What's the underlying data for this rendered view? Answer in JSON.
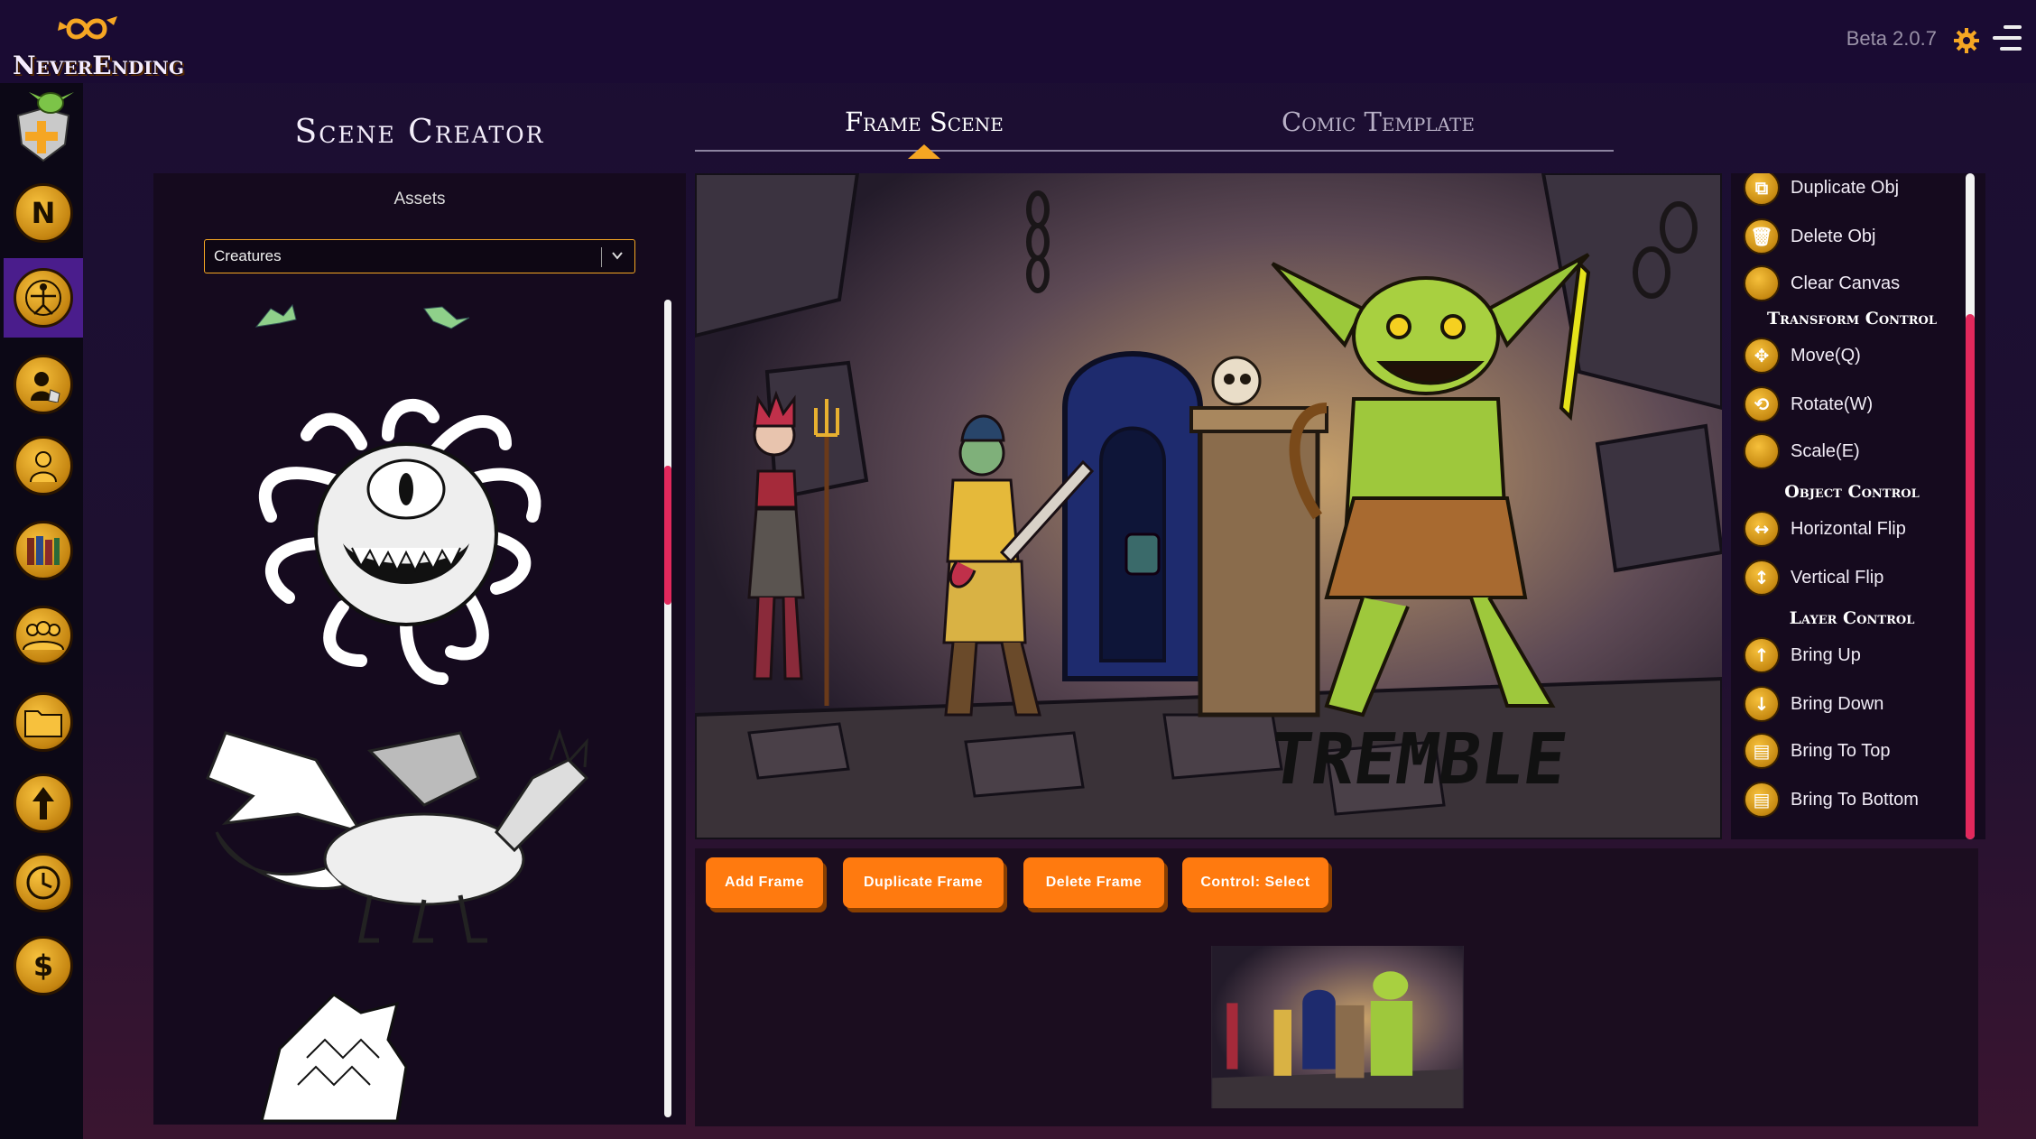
{
  "app": {
    "logo_text": "NeverEnding",
    "version": "Beta 2.0.7"
  },
  "sidebar": {
    "items": [
      {
        "name": "goblin-shield",
        "icon": "goblin-shield-icon"
      },
      {
        "name": "neverending-n",
        "icon": "n-logo-icon"
      },
      {
        "name": "scene-creator",
        "icon": "vitruvian-man-icon",
        "active": true
      },
      {
        "name": "character-dice",
        "icon": "character-dice-icon"
      },
      {
        "name": "profile",
        "icon": "person-icon"
      },
      {
        "name": "library",
        "icon": "books-icon"
      },
      {
        "name": "party",
        "icon": "group-icon"
      },
      {
        "name": "folder",
        "icon": "folder-icon"
      },
      {
        "name": "upgrade",
        "icon": "arrow-up-icon"
      },
      {
        "name": "history",
        "icon": "clock-icon"
      },
      {
        "name": "billing",
        "icon": "dollar-icon"
      }
    ]
  },
  "page": {
    "title": "Scene Creator"
  },
  "tabs": [
    {
      "label": "Frame Scene",
      "active": true
    },
    {
      "label": "Comic Template",
      "active": false
    }
  ],
  "assets": {
    "label": "Assets",
    "category": "Creatures",
    "items": [
      "beholder",
      "dragon",
      "wyvern-wing"
    ]
  },
  "canvas": {
    "caption": "TREMBLE"
  },
  "tools": {
    "actions": [
      {
        "label": "Duplicate Obj",
        "icon": "duplicate-icon"
      },
      {
        "label": "Delete Obj",
        "icon": "trash-icon"
      },
      {
        "label": "Clear Canvas",
        "icon": "clear-icon"
      }
    ],
    "transform_heading": "Transform Control",
    "transform": [
      {
        "label": "Move(Q)",
        "icon": "move-icon"
      },
      {
        "label": "Rotate(W)",
        "icon": "rotate-icon"
      },
      {
        "label": "Scale(E)",
        "icon": "scale-icon"
      }
    ],
    "object_heading": "Object Control",
    "object": [
      {
        "label": "Horizontal Flip",
        "icon": "horizontal-flip-icon"
      },
      {
        "label": "Vertical Flip",
        "icon": "vertical-flip-icon"
      }
    ],
    "layer_heading": "Layer Control",
    "layer": [
      {
        "label": "Bring Up",
        "icon": "arrow-up-icon"
      },
      {
        "label": "Bring Down",
        "icon": "arrow-down-icon"
      },
      {
        "label": "Bring To Top",
        "icon": "layers-top-icon"
      },
      {
        "label": "Bring To Bottom",
        "icon": "layers-bottom-icon"
      }
    ]
  },
  "frames": {
    "buttons": {
      "add": "Add Frame",
      "duplicate": "Duplicate Frame",
      "delete": "Delete Frame",
      "control": "Control: Select"
    }
  },
  "colors": {
    "accent": "#f5a623",
    "button": "#ff7a0f",
    "scroll_thumb": "#e2285c",
    "active_sidebar": "#4a1d8c"
  }
}
